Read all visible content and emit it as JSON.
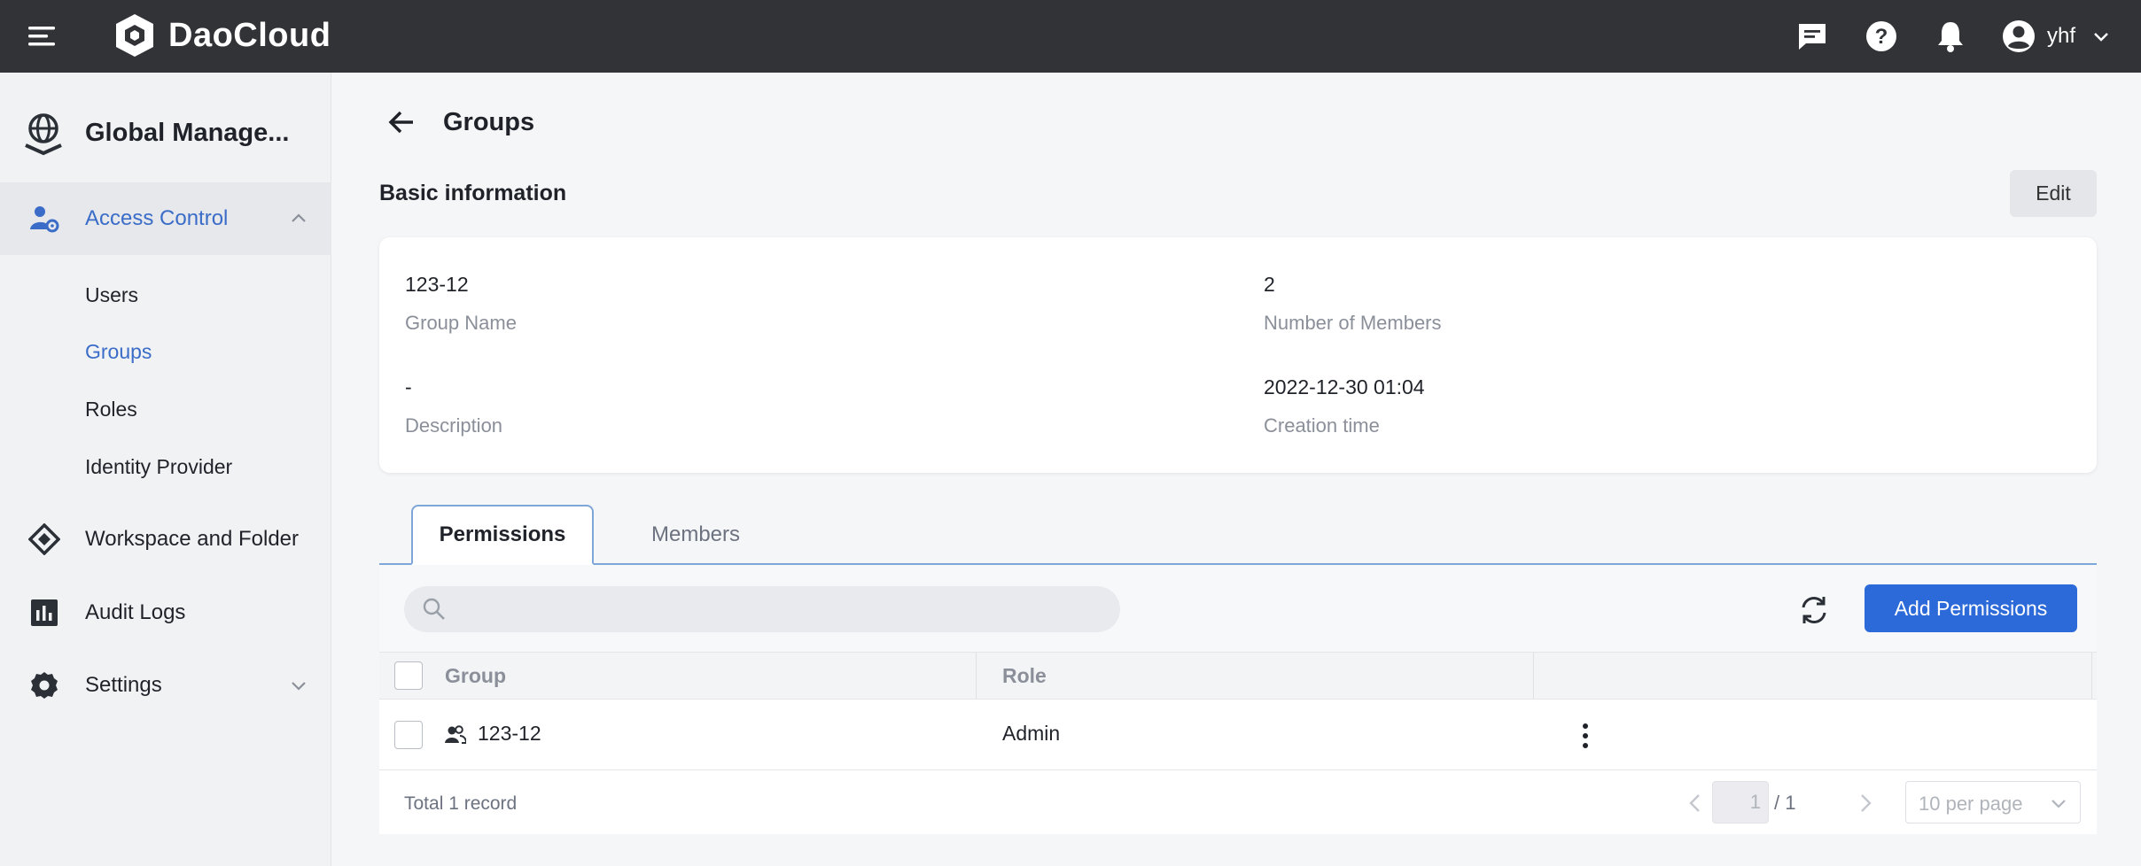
{
  "app": {
    "brand": "DaoCloud",
    "user": "yhf"
  },
  "sidebar": {
    "title": "Global Manage...",
    "sections": [
      {
        "label": "Access Control",
        "icon": "user-gear-icon",
        "expanded": true,
        "items": [
          {
            "label": "Users"
          },
          {
            "label": "Groups",
            "active": true
          },
          {
            "label": "Roles"
          },
          {
            "label": "Identity Provider"
          }
        ]
      },
      {
        "label": "Workspace and Folder",
        "icon": "workspace-icon"
      },
      {
        "label": "Audit Logs",
        "icon": "audit-logs-icon"
      },
      {
        "label": "Settings",
        "icon": "gear-icon",
        "expanded": false
      }
    ]
  },
  "page": {
    "title": "Groups",
    "section_title": "Basic information",
    "edit_label": "Edit"
  },
  "info": {
    "group_name": {
      "value": "123-12",
      "label": "Group Name"
    },
    "members": {
      "value": "2",
      "label": "Number of Members"
    },
    "description": {
      "value": "-",
      "label": "Description"
    },
    "created": {
      "value": "2022-12-30 01:04",
      "label": "Creation time"
    }
  },
  "tabs": [
    {
      "label": "Permissions",
      "active": true
    },
    {
      "label": "Members"
    }
  ],
  "toolbar": {
    "search_placeholder": "",
    "add_label": "Add Permissions"
  },
  "table": {
    "columns": [
      "Group",
      "Role"
    ],
    "rows": [
      {
        "group": "123-12",
        "role": "Admin"
      }
    ]
  },
  "footer": {
    "total": "Total 1 record",
    "page_current": "1",
    "page_total": "/ 1",
    "per_page": "10 per page"
  },
  "colors": {
    "accent": "#2d6ad9",
    "topbar": "#323337",
    "active_text": "#3a6cc8"
  }
}
